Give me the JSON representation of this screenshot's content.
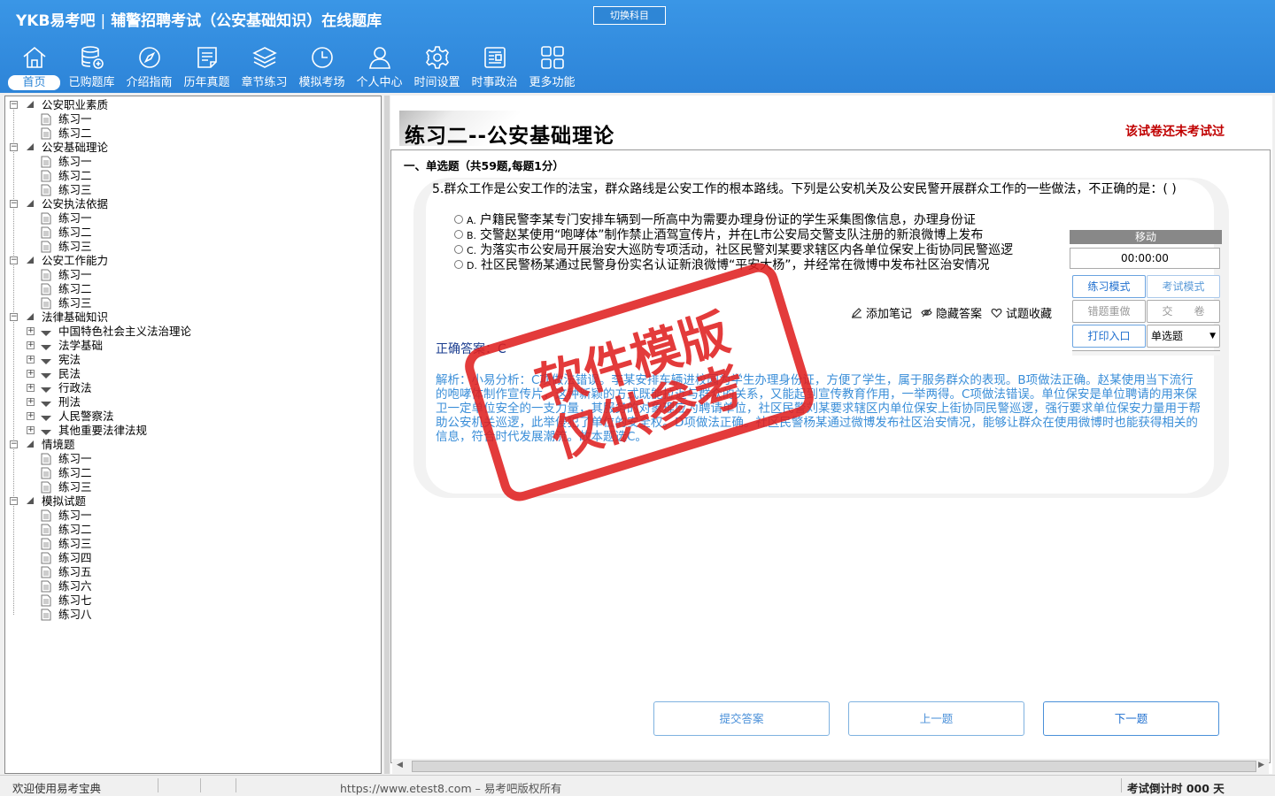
{
  "header": {
    "logo": "YKB易考吧",
    "app_title": "辅警招聘考试（公安基础知识）在线题库",
    "switch_subject": "切换科目",
    "nav": [
      {
        "label": "首页",
        "icon": "home-icon"
      },
      {
        "label": "已购题库",
        "icon": "database-icon"
      },
      {
        "label": "介绍指南",
        "icon": "compass-icon"
      },
      {
        "label": "历年真题",
        "icon": "list-doc-icon"
      },
      {
        "label": "章节练习",
        "icon": "layers-icon"
      },
      {
        "label": "模拟考场",
        "icon": "clock-icon"
      },
      {
        "label": "个人中心",
        "icon": "user-icon"
      },
      {
        "label": "时间设置",
        "icon": "gear-icon"
      },
      {
        "label": "时事政治",
        "icon": "newspaper-icon"
      },
      {
        "label": "更多功能",
        "icon": "grid-icon"
      }
    ]
  },
  "tree": [
    {
      "label": "公安职业素质",
      "children": [
        "练习一",
        "练习二"
      ]
    },
    {
      "label": "公安基础理论",
      "children": [
        "练习一",
        "练习二",
        "练习三"
      ]
    },
    {
      "label": "公安执法依据",
      "children": [
        "练习一",
        "练习二",
        "练习三"
      ]
    },
    {
      "label": "公安工作能力",
      "children": [
        "练习一",
        "练习二",
        "练习三"
      ]
    },
    {
      "label": "法律基础知识",
      "subgroups": [
        "中国特色社会主义法治理论",
        "法学基础",
        "宪法",
        "民法",
        "行政法",
        "刑法",
        "人民警察法",
        "其他重要法律法规"
      ]
    },
    {
      "label": "情境题",
      "children": [
        "练习一",
        "练习二",
        "练习三"
      ]
    },
    {
      "label": "模拟试题",
      "children": [
        "练习一",
        "练习二",
        "练习三",
        "练习四",
        "练习五",
        "练习六",
        "练习七",
        "练习八"
      ]
    }
  ],
  "exam": {
    "title": "练习二--公安基础理论",
    "status": "该试卷还未考试过",
    "section": "一、单选题（共59题,每题1分）",
    "question": "5.群众工作是公安工作的法宝，群众路线是公安工作的根本路线。下列是公安机关及公安民警开展群众工作的一些做法，不正确的是：( )",
    "options": [
      {
        "key": "A.",
        "text": "户籍民警李某专门安排车辆到一所高中为需要办理身份证的学生采集图像信息，办理身份证"
      },
      {
        "key": "B.",
        "text": "交警赵某使用“咆哮体”制作禁止酒驾宣传片，并在L市公安局交警支队注册的新浪微博上发布"
      },
      {
        "key": "C.",
        "text": "为落实市公安局开展治安大巡防专项活动，社区民警刘某要求辖区内各单位保安上街协同民警巡逻"
      },
      {
        "key": "D.",
        "text": "社区民警杨某通过民警身份实名认证新浪微博“平安大杨”，并经常在微博中发布社区治安情况"
      }
    ],
    "tools": {
      "note": "添加笔记",
      "hide_answer": "隐藏答案",
      "favorite": "试题收藏"
    },
    "answer": "正确答案：C",
    "analysis": "解析：小易分析：C项做法错误。李某安排车辆进校园为学生办理身份证，方便了学生，属于服务群众的表现。B项做法正确。赵某使用当下流行的咆哮体制作宣传片，这种新颖的方式既能拉近与群众的关系，又能起到宣传教育作用，一举两得。C项做法错误。单位保安是单位聘请的用来保卫一定单位安全的一支力量，其服务的对象理应为聘请单位，社区民警刘某要求辖区内单位保安上街协同民警巡逻，强行要求单位保安力量用于帮助公安机关巡逻，此举侵犯了单位的安全权。D项做法正确。社区民警杨某通过微博发布社区治安情况，能够让群众在使用微博时也能获得相关的信息，符合时代发展潮流。故本题选C。"
  },
  "control": {
    "move": "移动",
    "timer": "00:00:00",
    "practice_mode": "练习模式",
    "exam_mode": "考试模式",
    "redo_wrong": "错题重做",
    "submit_paper": "交　　卷",
    "print": "打印入口",
    "type_select": "单选题"
  },
  "buttons": {
    "submit": "提交答案",
    "prev": "上一题",
    "next": "下一题"
  },
  "watermark": {
    "line1": "软件模版",
    "line2": "仅供参考"
  },
  "statusbar": {
    "welcome": "欢迎使用易考宝典",
    "url": "https://www.etest8.com – 易考吧版权所有",
    "countdown": "考试倒计时 000 天"
  },
  "colors": {
    "header_blue": "#2e86d6",
    "status_red": "#c00000",
    "answer_blue": "#1a3c8f",
    "analysis_blue": "#3a8ed8",
    "stamp_red": "#e02020"
  }
}
